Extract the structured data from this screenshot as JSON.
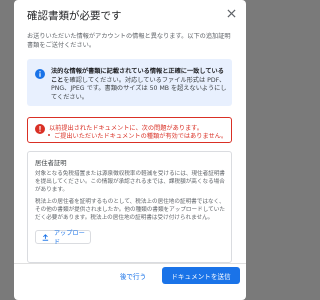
{
  "dialog": {
    "title": "確認書類が必要です",
    "intro": "お送りいただいた情報がアカウントの情報と異なります。以下の追加証明書類をご送付ください。",
    "info": {
      "bold": "法的な情報が書類に記載されている情報と正確に一致していること",
      "text": "を確認してください。対応しているファイル形式は PDF、PNG、JPEG です。書類のサイズは 50 MB を超えないようにしてください。"
    },
    "error": {
      "title": "以前提出されたドキュメントに、次の問題があります。",
      "item": "ご提出いただいたドキュメントの種類が有効ではありません。"
    },
    "section": {
      "title": "居住者証明",
      "p1": "対象となる免税措置または源泉徴収税率の軽減を受けるには、現住者証明書を提出してください。この情報が承認されるまでは、課税額が高くなる場合があります。",
      "p2": "税法上の居住者を証明するものとして、税法上の居住地の証明書ではなく、その他の書類が提供されましたか。他の種類の書類をアップロードしていただく必要があります。税法上の居住地の証明書は受け付けられません。",
      "upload_label": "アップロード"
    },
    "footer": {
      "later_label": "後で行う",
      "submit_label": "ドキュメントを送信"
    }
  },
  "colors": {
    "accent": "#1a73e8",
    "error": "#d93025",
    "info_bg": "#e8f0fe"
  },
  "icons": [
    "close-icon",
    "info-icon",
    "error-icon",
    "upload-icon"
  ]
}
